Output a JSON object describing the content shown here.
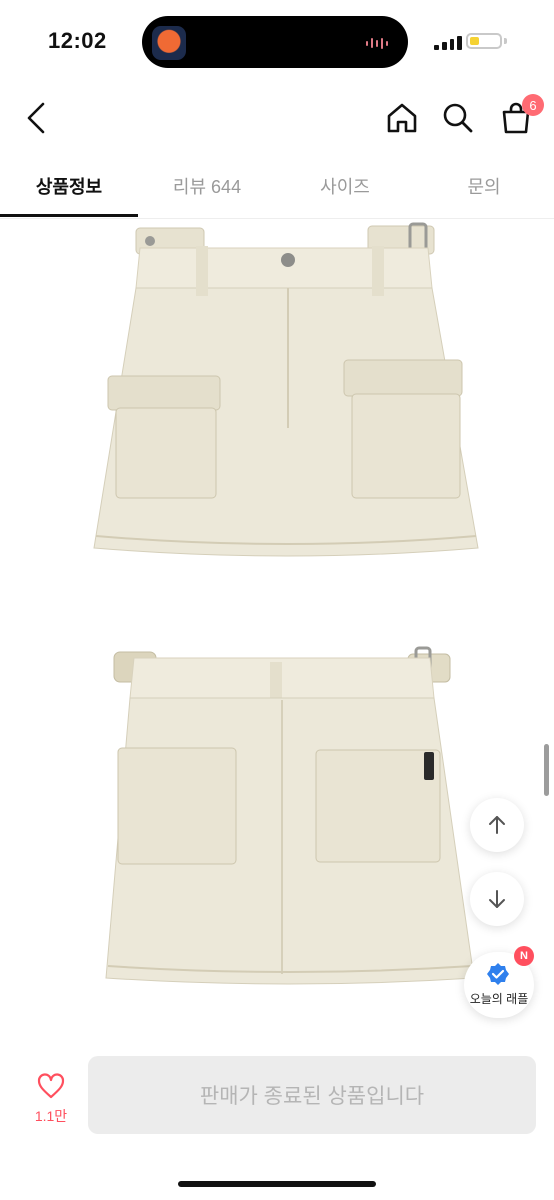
{
  "status_bar": {
    "time": "12:02"
  },
  "header": {
    "cart_count": "6"
  },
  "tabs": [
    {
      "label": "상품정보",
      "active": true
    },
    {
      "label": "리뷰 644",
      "active": false
    },
    {
      "label": "사이즈",
      "active": false
    },
    {
      "label": "문의",
      "active": false
    }
  ],
  "images": [
    {
      "name": "skirt-front-image",
      "description_icon": "skirt-front"
    },
    {
      "name": "skirt-back-image",
      "description_icon": "skirt-back"
    }
  ],
  "floating": {
    "raffle_label": "오늘의 래플",
    "raffle_badge": "N"
  },
  "bottom_bar": {
    "like_count": "1.1만",
    "purchase_label": "판매가 종료된 상품입니다"
  },
  "colors": {
    "accent": "#ff4f5e",
    "badge": "#ff6b73",
    "skirt": "#ebe7d7",
    "disabled_button": "#ececec"
  }
}
